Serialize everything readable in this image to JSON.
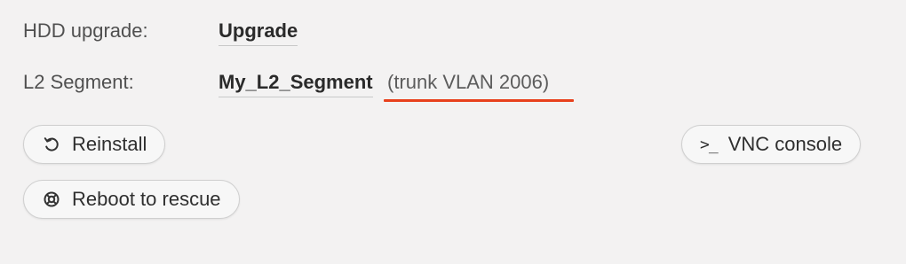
{
  "details": {
    "hdd_upgrade": {
      "label": "HDD upgrade:",
      "value": "Upgrade"
    },
    "l2_segment": {
      "label": "L2 Segment:",
      "value": "My_L2_Segment",
      "note": "(trunk VLAN 2006)"
    }
  },
  "actions": {
    "reinstall": {
      "label": "Reinstall",
      "icon": "reinstall-icon"
    },
    "vnc_console": {
      "label": "VNC console",
      "icon_text": ">_",
      "icon": "terminal-icon"
    },
    "reboot_rescue": {
      "label": "Reboot to rescue",
      "icon": "lifebuoy-icon"
    }
  },
  "colors": {
    "accent_underline": "#e8401c",
    "background": "#f3f2f2"
  }
}
